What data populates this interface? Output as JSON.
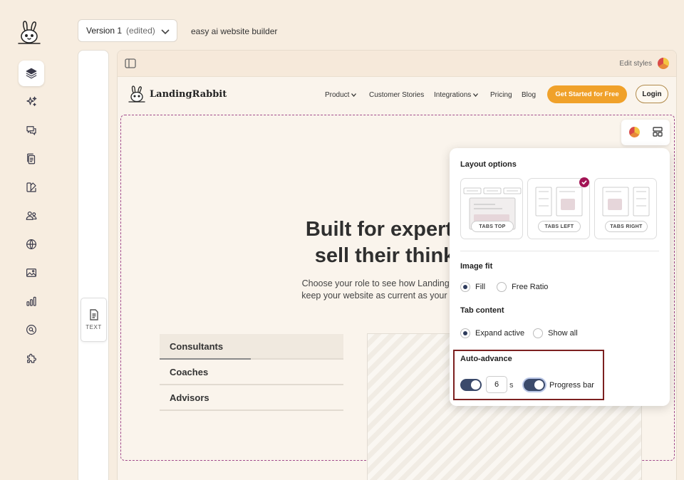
{
  "topbar": {
    "version_name": "Version 1",
    "version_state": "(edited)",
    "site_name": "easy ai website builder"
  },
  "rail": {
    "items": [
      {
        "icon": "layers-icon",
        "active": true
      },
      {
        "icon": "sparkles-icon"
      },
      {
        "icon": "chat-icon"
      },
      {
        "icon": "pages-icon"
      },
      {
        "icon": "theme-icon"
      },
      {
        "icon": "users-icon"
      },
      {
        "icon": "globe-icon"
      },
      {
        "icon": "image-icon"
      },
      {
        "icon": "chart-icon"
      },
      {
        "icon": "search-icon"
      },
      {
        "icon": "puzzle-icon"
      }
    ]
  },
  "text_block": {
    "label": "TEXT"
  },
  "canvas": {
    "edit_styles": "Edit styles"
  },
  "site": {
    "brand": "LandingRabbit",
    "nav": [
      "Product",
      "Customer Stories",
      "Integrations",
      "Pricing",
      "Blog"
    ],
    "cta": "Get Started for Free",
    "login": "Login"
  },
  "hero": {
    "title_line1": "Built for experts",
    "title_line2": "sell their think",
    "sub_line1": "Choose your role to see how LandingRabl",
    "sub_line2": "keep your website as current as your clien"
  },
  "tabs": [
    "Consultants",
    "Coaches",
    "Advisors"
  ],
  "popover": {
    "layout_heading": "Layout options",
    "layouts": [
      "TABS TOP",
      "TABS LEFT",
      "TABS RIGHT"
    ],
    "selected_layout": "TABS LEFT",
    "image_fit_heading": "Image fit",
    "image_fit_options": [
      "Fill",
      "Free Ratio"
    ],
    "image_fit_selected": "Fill",
    "tab_content_heading": "Tab content",
    "tab_content_options": [
      "Expand active",
      "Show all"
    ],
    "tab_content_selected": "Expand active",
    "auto_advance_heading": "Auto-advance",
    "auto_advance_enabled": true,
    "seconds": "6",
    "seconds_unit": "s",
    "progress_bar_label": "Progress bar",
    "progress_bar_enabled": true
  },
  "colors": {
    "accent": "#f0a12a",
    "selection": "#a24b8c",
    "toggle": "#3b4a6b",
    "badge": "#a21455"
  }
}
